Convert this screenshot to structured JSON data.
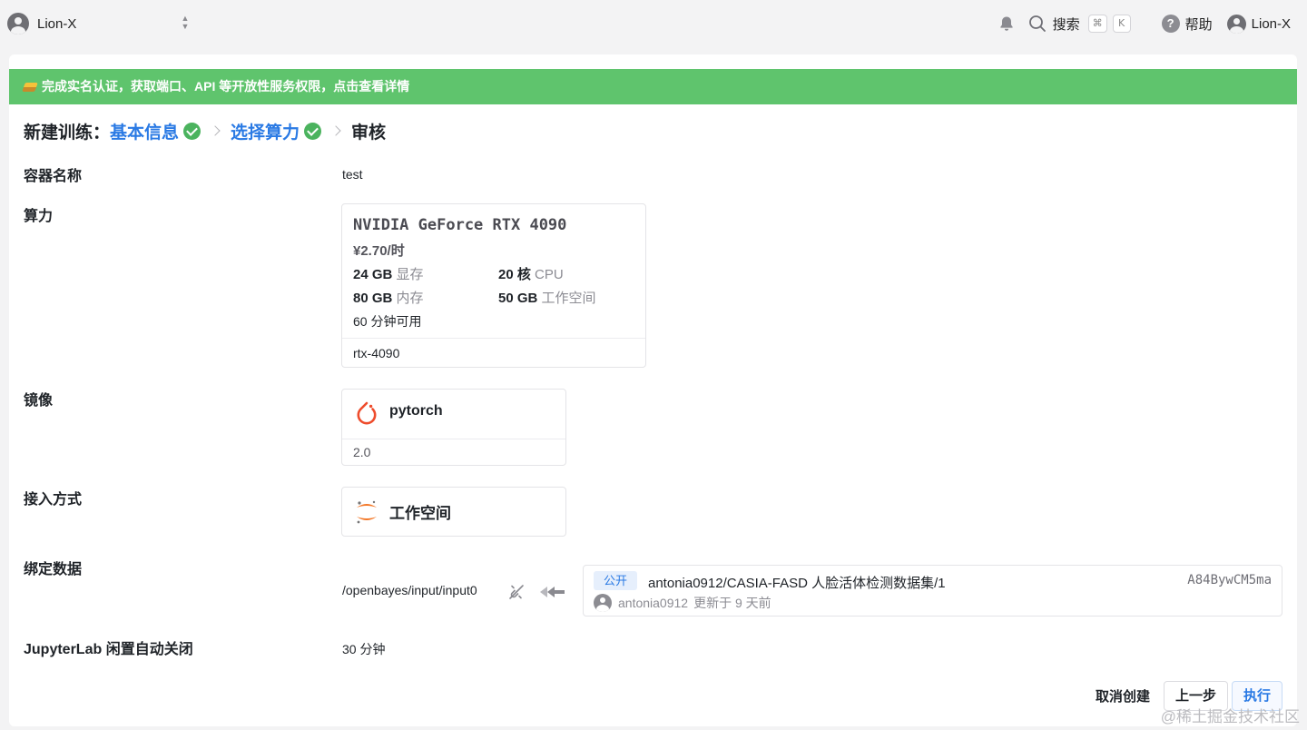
{
  "topbar": {
    "org_name": "Lion-X",
    "search_label": "搜索",
    "search_shortcut": [
      "⌘",
      "K"
    ],
    "help_label": "帮助",
    "user_name": "Lion-X"
  },
  "banner": {
    "text": "完成实名认证，获取端口、API 等开放性服务权限，点击查看详情",
    "color": "#5fc46d"
  },
  "steps": {
    "prefix": "新建训练：",
    "items": [
      {
        "label": "基本信息",
        "done": true
      },
      {
        "label": "选择算力",
        "done": true
      },
      {
        "label": "审核",
        "done": false
      }
    ]
  },
  "form": {
    "container_name": {
      "label": "容器名称",
      "value": "test"
    },
    "compute": {
      "label": "算力",
      "gpu_name": "NVIDIA GeForce RTX 4090",
      "price": "¥2.70/时",
      "specs": [
        {
          "amount": "24 GB",
          "unit": "显存"
        },
        {
          "amount": "20 核",
          "unit": "CPU"
        },
        {
          "amount": "80 GB",
          "unit": "内存"
        },
        {
          "amount": "50 GB",
          "unit": "工作空间"
        }
      ],
      "availability": "60 分钟可用",
      "code": "rtx-4090"
    },
    "image": {
      "label": "镜像",
      "name": "pytorch",
      "version": "2.0"
    },
    "access": {
      "label": "接入方式",
      "name": "工作空间"
    },
    "binding": {
      "label": "绑定数据",
      "path": "/openbayes/input/input0",
      "dataset": {
        "visibility": "公开",
        "name": "antonia0912/CASIA-FASD 人脸活体检测数据集/1",
        "hash": "A84BywCM5ma",
        "owner": "antonia0912",
        "updated": "更新于 9 天前"
      }
    },
    "idle_shutdown": {
      "label": "JupyterLab 闲置自动关闭",
      "value": "30 分钟"
    }
  },
  "actions": {
    "cancel": "取消创建",
    "prev": "上一步",
    "run": "执行"
  },
  "watermark": "@稀土掘金技术社区",
  "colors": {
    "accent": "#2a7ae4",
    "success": "#4bb35e",
    "pytorch": "#ee4c2c",
    "jupyter": "#f37726"
  }
}
